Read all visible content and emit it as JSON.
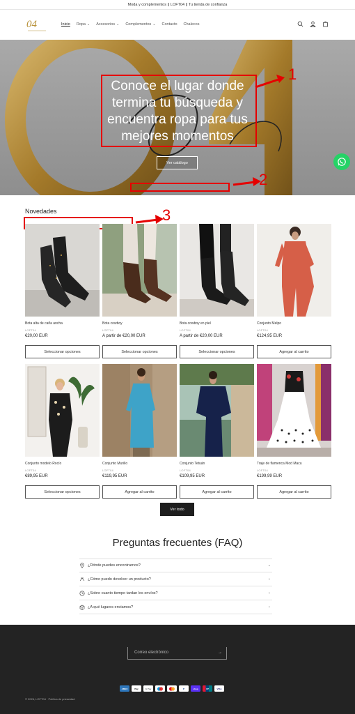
{
  "announcement": "Moda y complementos || LOFT04 || Tu tienda de confianza",
  "nav": {
    "items": [
      {
        "label": "Inicio",
        "active": true,
        "dropdown": false
      },
      {
        "label": "Ropa",
        "active": false,
        "dropdown": true
      },
      {
        "label": "Accesorios",
        "active": false,
        "dropdown": true
      },
      {
        "label": "Complementos",
        "active": false,
        "dropdown": true
      },
      {
        "label": "Contacto",
        "active": false,
        "dropdown": false
      },
      {
        "label": "Chalecos",
        "active": false,
        "dropdown": false
      }
    ],
    "icons": [
      "search-icon",
      "account-icon",
      "cart-icon"
    ]
  },
  "hero": {
    "headline": "Conoce el lugar donde termina tu búsqueda y encuentra ropa para tus mejores momentos",
    "button": "Ver catálogo",
    "annotations": [
      "1",
      "2",
      "3"
    ]
  },
  "products_section": {
    "title": "Novedades",
    "view_all": "Ver todo",
    "products": [
      {
        "name": "Bota alta de caña ancha",
        "vendor": "LOFT04",
        "price": "€20,00 EUR",
        "button": "Seleccionar opciones"
      },
      {
        "name": "Bota cowboy",
        "vendor": "LOFT04",
        "price": "A partir de €20,00 EUR",
        "button": "Seleccionar opciones"
      },
      {
        "name": "Bota cowboy en piel",
        "vendor": "LOFT04",
        "price": "A partir de €20,00 EUR",
        "button": "Seleccionar opciones"
      },
      {
        "name": "Conjunto Melpo",
        "vendor": "LOFT04",
        "price": "€124,95 EUR",
        "button": "Agregar al carrito"
      },
      {
        "name": "Conjunto modelo Rocío",
        "vendor": "LOFT04",
        "price": "€89,95 EUR",
        "button": "Seleccionar opciones"
      },
      {
        "name": "Conjunto Murillo",
        "vendor": "LOFT04",
        "price": "€119,95 EUR",
        "button": "Agregar al carrito"
      },
      {
        "name": "Conjunto Tetuán",
        "vendor": "LOFT04",
        "price": "€109,95 EUR",
        "button": "Agregar al carrito"
      },
      {
        "name": "Traje de flamenca Mod Macu",
        "vendor": "LOFT04",
        "price": "€199,99 EUR",
        "button": "Agregar al carrito"
      }
    ]
  },
  "faq": {
    "title": "Preguntas frecuentes (FAQ)",
    "items": [
      {
        "icon": "map-pin-icon",
        "question": "¿Dónde puedes encontrarnos?"
      },
      {
        "icon": "return-icon",
        "question": "¿Cómo puedo devolver un producto?"
      },
      {
        "icon": "clock-icon",
        "question": "¿Sobre cuanto tiempo tardan los envíos?"
      },
      {
        "icon": "box-icon",
        "question": "¿A qué lugares enviamos?"
      }
    ]
  },
  "footer": {
    "email_placeholder": "Correo electrónico",
    "payments": [
      "American Express",
      "Apple Pay",
      "Google Pay",
      "Maestro",
      "Mastercard",
      "PayPal",
      "Shop Pay",
      "Union Pay",
      "Visa"
    ],
    "copyright": "© 2026, LOFT04",
    "privacy": "Política de privacidad"
  },
  "colors": {
    "accent": "#1e1e1e",
    "annotation": "#e50000",
    "whatsapp": "#25d366",
    "footer_bg": "#232323",
    "hero_gold": "#b8923a"
  }
}
